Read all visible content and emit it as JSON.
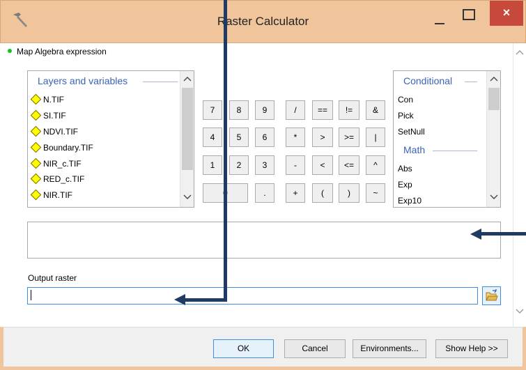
{
  "window": {
    "title": "Raster Calculator",
    "close_glyph": "×",
    "title_bar_color": "#f0c59b",
    "close_button_color": "#c6493b"
  },
  "expression_section": {
    "label": "Map Algebra expression"
  },
  "layers_panel": {
    "header": "Layers and variables",
    "items": [
      "N.TIF",
      "SI.TIF",
      "NDVI.TIF",
      "Boundary.TIF",
      "NIR_c.TIF",
      "RED_c.TIF",
      "NIR.TIF"
    ],
    "item_icon": "raster-layer-diamond-icon"
  },
  "keypad": {
    "rows": [
      [
        "7",
        "8",
        "9",
        "/",
        "==",
        "!=",
        "&"
      ],
      [
        "4",
        "5",
        "6",
        "*",
        ">",
        ">=",
        "|"
      ],
      [
        "1",
        "2",
        "3",
        "-",
        "<",
        "<=",
        "^"
      ],
      [
        "0",
        ".",
        "+",
        "(",
        ")",
        "~"
      ]
    ]
  },
  "tools_panel": {
    "sections": [
      {
        "header": "Conditional",
        "items": [
          "Con",
          "Pick",
          "SetNull"
        ]
      },
      {
        "header": "Math",
        "items": [
          "Abs",
          "Exp",
          "Exp10"
        ]
      }
    ]
  },
  "expression_box": {
    "value": ""
  },
  "output": {
    "label": "Output raster",
    "value": "",
    "browse_icon": "open-folder-icon"
  },
  "buttons": {
    "ok": "OK",
    "cancel": "Cancel",
    "environments": "Environments...",
    "show_help": "Show Help >>"
  },
  "accent_color": "#3a63b8",
  "annotation_color": "#1f3b63"
}
